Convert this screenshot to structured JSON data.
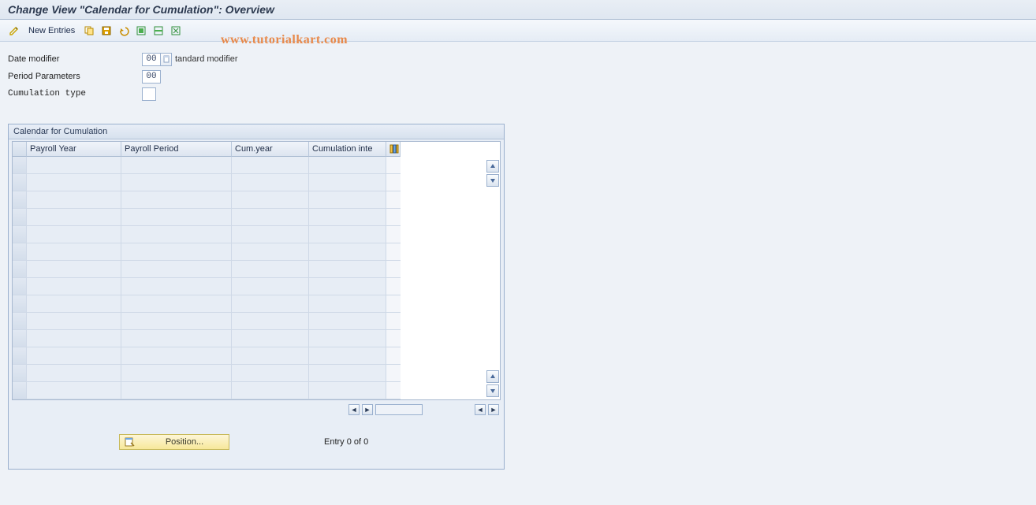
{
  "title": "Change View \"Calendar for Cumulation\": Overview",
  "toolbar": {
    "new_entries_label": "New Entries"
  },
  "watermark": "www.tutorialkart.com",
  "fields": {
    "date_modifier": {
      "label": "Date modifier",
      "value": "00",
      "desc": "tandard modifier"
    },
    "period_parameters": {
      "label": "Period Parameters",
      "value": "00"
    },
    "cumulation_type": {
      "label": "Cumulation type",
      "value": ""
    }
  },
  "panel": {
    "title": "Calendar for Cumulation",
    "columns": {
      "payroll_year": "Payroll Year",
      "payroll_period": "Payroll Period",
      "cum_year": "Cum.year",
      "cum_inte": "Cumulation inte"
    },
    "row_count": 14
  },
  "footer": {
    "position_label": "Position...",
    "entry_text": "Entry 0 of 0"
  }
}
